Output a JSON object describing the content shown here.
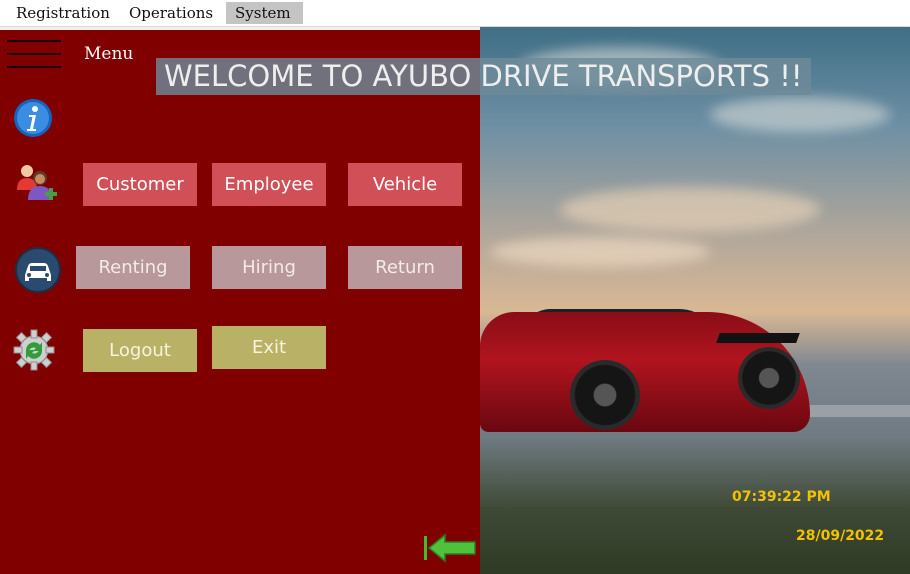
{
  "menubar": {
    "items": [
      {
        "label": "Registration"
      },
      {
        "label": "Operations"
      },
      {
        "label": "System"
      }
    ]
  },
  "sidebar": {
    "menu_label": "Menu",
    "icons": {
      "info": "info-icon",
      "users": "add-user-icon",
      "car": "car-icon",
      "settings": "gear-refresh-icon",
      "back": "back-arrow-icon"
    }
  },
  "banner": {
    "title": "WELCOME TO AYUBO DRIVE TRANSPORTS !!"
  },
  "registration_buttons": {
    "customer": "Customer",
    "employee": "Employee",
    "vehicle": "Vehicle"
  },
  "operation_buttons": {
    "renting": "Renting",
    "hiring": "Hiring",
    "return": "Return"
  },
  "system_buttons": {
    "logout": "Logout",
    "exit": "Exit"
  },
  "status": {
    "time": "07:39:22 PM",
    "date": "28/09/2022"
  },
  "colors": {
    "panel": "#800000",
    "registration_button": "#d15058",
    "operation_button": "#b8989a",
    "system_button": "#b9b266",
    "clock": "#f2c200"
  }
}
